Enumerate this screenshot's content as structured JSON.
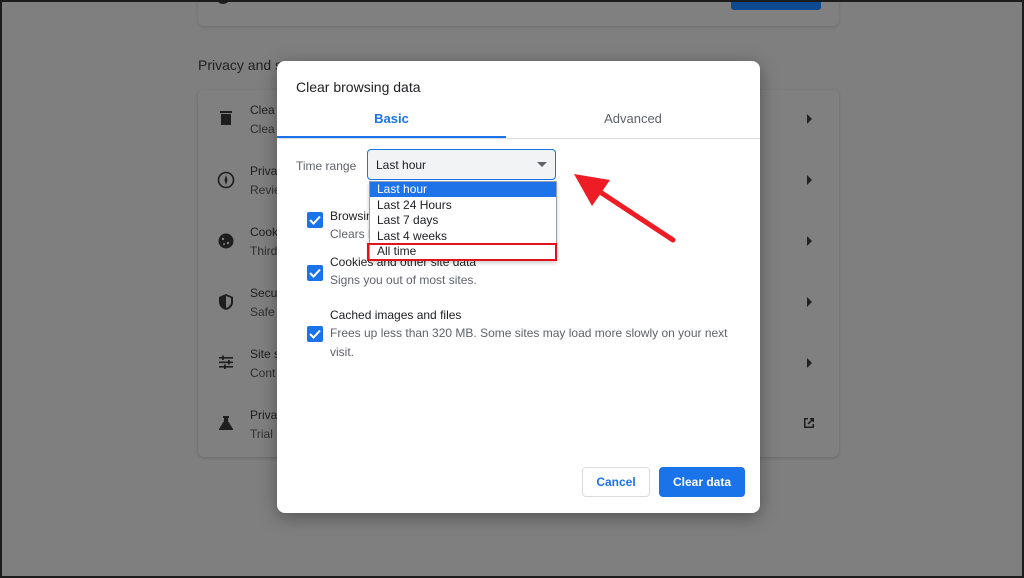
{
  "background": {
    "section_title": "Privacy and s",
    "rows": [
      {
        "title": "Clea",
        "desc": "Clea",
        "icon": "trash-icon"
      },
      {
        "title": "Priva",
        "desc": "Revie",
        "icon": "privacy-guide-icon"
      },
      {
        "title": "Cook",
        "desc": "Third",
        "icon": "cookie-icon"
      },
      {
        "title": "Secu",
        "desc": "Safe",
        "icon": "shield-icon"
      },
      {
        "title": "Site s",
        "desc": "Cont",
        "icon": "sliders-icon"
      },
      {
        "title": "Priva",
        "desc": "Trial",
        "icon": "flask-icon"
      }
    ]
  },
  "dialog": {
    "title": "Clear browsing data",
    "tabs": [
      {
        "label": "Basic",
        "active": true
      },
      {
        "label": "Advanced",
        "active": false
      }
    ],
    "time_range": {
      "label": "Time range",
      "value": "Last hour",
      "options": [
        "Last hour",
        "Last 24 Hours",
        "Last 7 days",
        "Last 4 weeks",
        "All time"
      ],
      "highlighted_option": "All time"
    },
    "options": [
      {
        "title": "Browsing history",
        "desc": "Clears history, including in the search box.",
        "checked": true
      },
      {
        "title": "Cookies and other site data",
        "desc": "Signs you out of most sites.",
        "checked": true
      },
      {
        "title": "Cached images and files",
        "desc": "Frees up less than 320 MB. Some sites may load more slowly on your next visit.",
        "checked": true
      }
    ],
    "cancel_label": "Cancel",
    "clear_label": "Clear data"
  },
  "colors": {
    "accent": "#1a73e8",
    "annotation": "#e0121a",
    "overlay": "#7f7f7f"
  }
}
